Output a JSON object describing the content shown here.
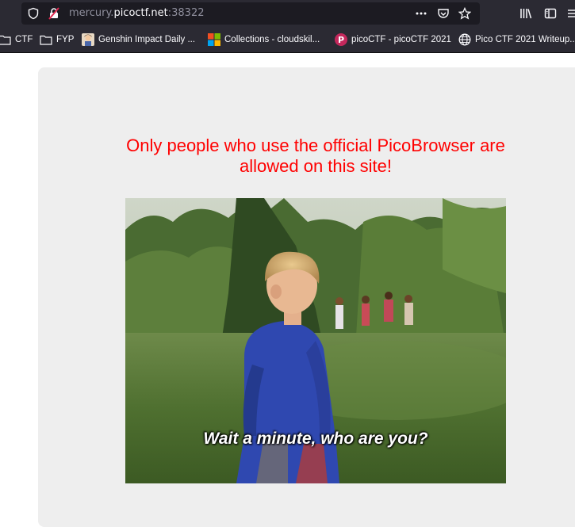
{
  "browser": {
    "url_prefix": "mercury.",
    "url_host": "picoctf.net",
    "url_suffix": ":38322",
    "page_actions_icon": "ellipsis-icon",
    "pocket_icon": "pocket-icon",
    "bookmark_star_icon": "star-icon",
    "library_icon": "library-icon",
    "sidebar_icon": "sidebar-icon"
  },
  "bookmarks": [
    {
      "label": "CTF",
      "icon": "folder-icon"
    },
    {
      "label": "FYP",
      "icon": "folder-icon"
    },
    {
      "label": "Genshin Impact Daily ...",
      "icon": "genshin-favicon"
    },
    {
      "label": "Collections - cloudskil...",
      "icon": "microsoft-favicon"
    },
    {
      "label": "picoCTF - picoCTF 2021",
      "icon": "picoctf-favicon"
    },
    {
      "label": "Pico CTF 2021 Writeup...",
      "icon": "globe-icon"
    }
  ],
  "page": {
    "headline": "Only people who use the official PicoBrowser are allowed on this site!",
    "image_caption": "Wait a minute, who are you?"
  },
  "colors": {
    "chrome_bg": "#2b2a33",
    "urlbar_bg": "#1c1b22",
    "card_bg": "#eeeeee",
    "headline": "#ff0000"
  }
}
